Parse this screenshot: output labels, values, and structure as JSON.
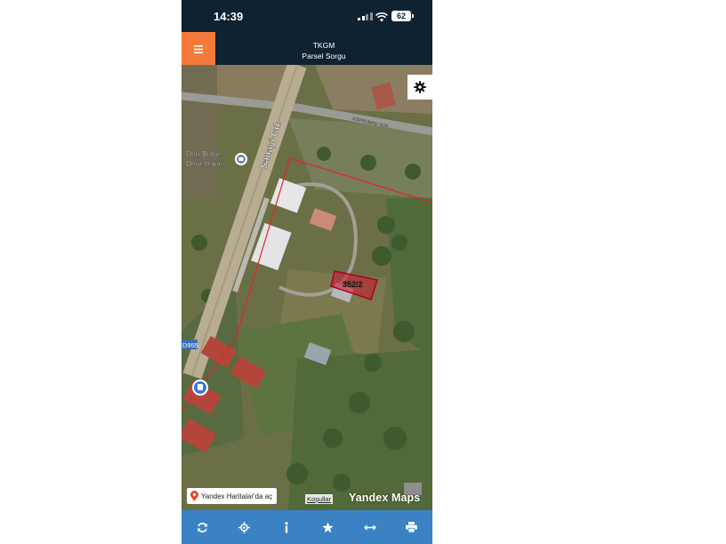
{
  "status_bar": {
    "time": "14:39",
    "battery": "62"
  },
  "header": {
    "menu_icon": "hamburger-icon",
    "title_line1": "TKGM",
    "title_line2": "Parsel Sorgu",
    "accent_color": "#f47a3c",
    "bar_color": "#0e2232"
  },
  "map": {
    "road_labels": {
      "main": "Sanayi Cd.",
      "side": "KÖPRÜBAŞI SOK."
    },
    "poi_labels": {
      "line1": "Oltu Bölge",
      "line2": "Denetleme"
    },
    "route_badge": "D955",
    "parcel_label": "352/2",
    "parcel_color": "#c8102e",
    "settings_icon": "gear-icon",
    "open_in_yandex": "Yandex Haritalar'da aç",
    "terms_link": "Koşullar",
    "attribution": "Yandex Maps"
  },
  "toolbar": {
    "color": "#3a82c4",
    "icons": [
      "refresh-icon",
      "locate-icon",
      "info-icon",
      "star-icon",
      "measure-icon",
      "print-icon"
    ]
  }
}
